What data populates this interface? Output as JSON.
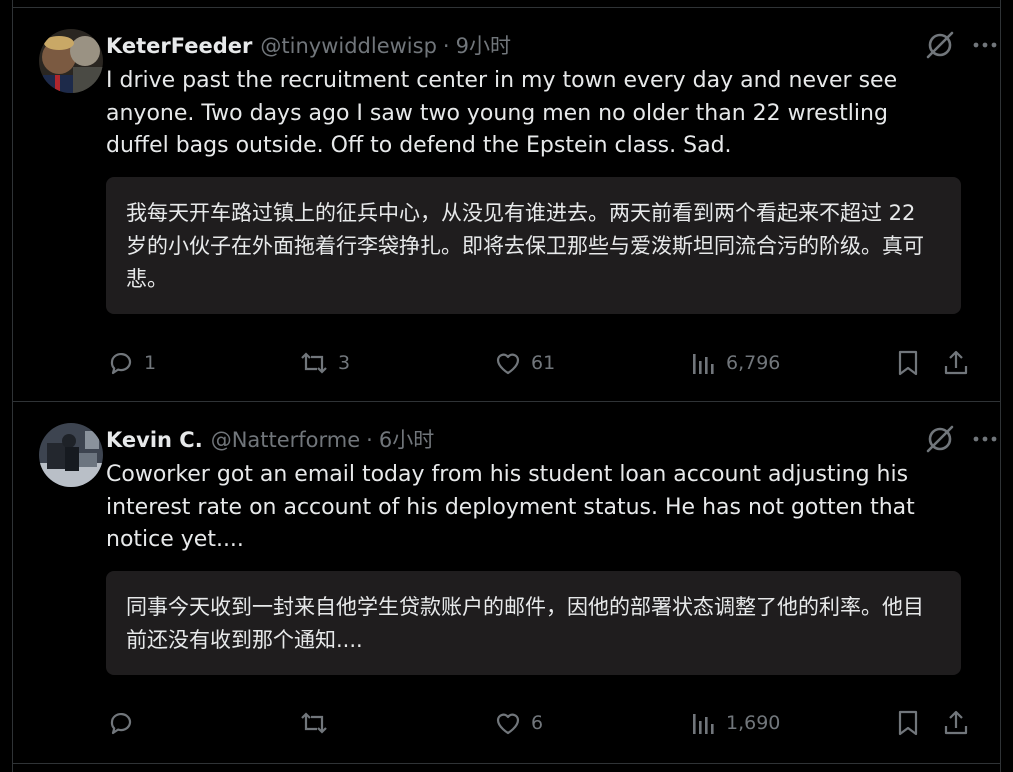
{
  "tweets": [
    {
      "name": "KeterFeeder",
      "handle": "@tinywiddlewisp",
      "time": "9小时",
      "text": "I drive past the recruitment center in my town every day and never see anyone. Two days ago I saw two young men no older than 22 wrestling duffel bags outside. Off to defend the Epstein class. Sad.",
      "translation": "我每天开车路过镇上的征兵中心，从没见有谁进去。两天前看到两个看起来不超过 22 岁的小伙子在外面拖着行李袋挣扎。即将去保卫那些与爱泼斯坦同流合污的阶级。真可悲。",
      "replies": "1",
      "retweets": "3",
      "likes": "61",
      "views": "6,796"
    },
    {
      "name": "Kevin C.",
      "handle": "@Natterforme",
      "time": "6小时",
      "text": "Coworker got an email today from his student loan account adjusting his interest rate on account of his deployment status. He has not gotten that notice yet....",
      "translation": "同事今天收到一封来自他学生贷款账户的邮件，因他的部署状态调整了他的利率。他目前还没有收到那个通知....",
      "replies": "",
      "retweets": "",
      "likes": "6",
      "views": "1,690"
    }
  ],
  "separator": "·",
  "colors": {
    "background": "#000000",
    "text": "#e7e9ea",
    "muted": "#71767b",
    "border": "#2f3336",
    "translation_bg": "#1f1d1e"
  }
}
